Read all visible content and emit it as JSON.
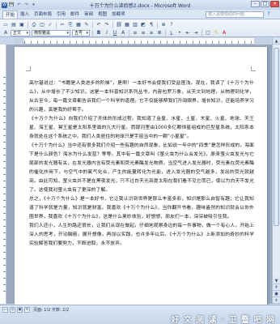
{
  "window": {
    "title": "十万个为什么读后感2.docx - Microsoft Word"
  },
  "quick_access": [
    "W",
    "💾",
    "↶",
    "↷",
    "▾"
  ],
  "tabs": [
    "开始",
    "插入",
    "页面布局",
    "引用",
    "邮件",
    "审阅",
    "视图",
    "加载项"
  ],
  "help_search_placeholder": "键入需要帮助的问题",
  "ribbon": {
    "style_value": "正文",
    "font_value": "微软雅黑",
    "size_value": "五号"
  },
  "document": {
    "paragraphs": [
      "高尔基说过：“书籍是人类进步的阶梯”，是啊！一本好书会使我们受益匪浅。现在，我读了《十万个为什么》，从中增长了不少知识。这是一本科普知识系列丛书，内容包罗万象，从天文到地理，从物理到化学，从古至今，每一篇文章都告诉我们一个科学的道理。它不仅能够帮我们开阔眼界，增长知识，还能培养学习的兴趣，真是我的好帮手。",
      "《十万个为什么》向我们介绍了天体的形成过程。我知道了金星、水星、土星、木星、火星、地球、天王星、海王星、冥王星是太阳系里面的九大行星。而银河里由1000多亿颗恒星组成的巨型星系统，太阳系本身就处在这个系统之中。我们人类居住的地球只是宇宙当中的一颗“小星星”。",
      "《十万个为什么》当中还有很多我们介绍一些有趣的自然现象，比如说一年中的“四季”是怎样形成的，海面下是什么颜色？海水为什么发蓝？等等。其中有一篇文章叫《萤火虫为什么会发光》，原来萤火虫发光与它尾部的发光器有关，在发光器内含有荧光素和荧光素酶发光物质。当空气进入发光器时，荧光素在荧光素酶的催化作用下，与空气中的氧气化合，产生的能量转化为光能，进入发光器的空气越多，发出的荧光就越亮。由此可知，萤火虫并不是在黑夜发光，只不过白天光亮度太阳在我们看不见它而已，使以为白天不发光了。这使我对萤火虫有了更深的了解。",
      "总之，《十万个为什么》是一本好书，它让我认识到世界是那么丰富多彩，知识是那么自智有趣；它让我知道了科学就是力量，知识就是财富。我喜欢《十万个为什么》，当你翻开书看，趣味盎然的知识就会以你外围世界，我喜欢《十万个为什么》，这是什么奥妙体验，好想想，朋友们一本，深深被吸引住我。",
      "我们人还小，人生的路还很长，让我们从现在做起，仔细地观察身边的每一件事物，做一个有心人，开始上深入的思考，开动脑筋，展开想像，再加以实践。也许多年以后，《十万个为什么》上新添加的奇妙的科学实验解答我们要努力，不断进取，永不放弃。"
    ]
  },
  "status": {
    "page_info": "页面: 1/2",
    "words": "字数: 1,187",
    "lang": "中文(中国)",
    "zoom": "缩放: 57%"
  },
  "status_left": "页面: 1/2   字数: 2/2",
  "watermark": "好 文 阅 读 · 卫 暨 吧 网"
}
